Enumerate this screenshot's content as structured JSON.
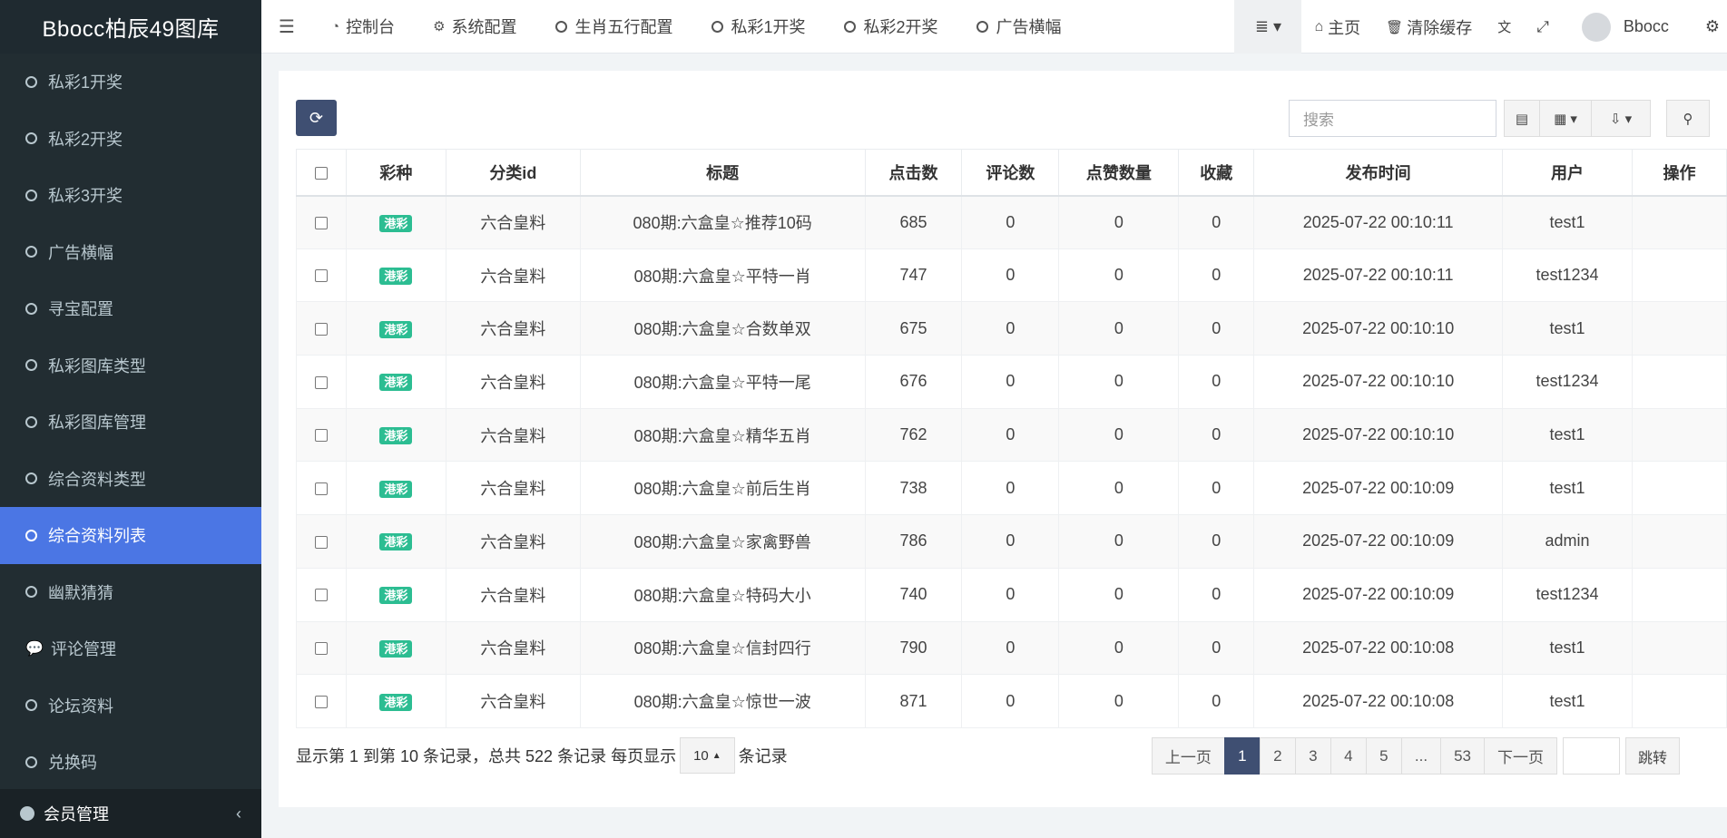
{
  "brand": "Bbocc柏辰49图库",
  "sidebar": {
    "items": [
      {
        "label": "私彩1开奖"
      },
      {
        "label": "私彩2开奖"
      },
      {
        "label": "私彩3开奖"
      },
      {
        "label": "广告横幅"
      },
      {
        "label": "寻宝配置"
      },
      {
        "label": "私彩图库类型"
      },
      {
        "label": "私彩图库管理"
      },
      {
        "label": "综合资料类型"
      },
      {
        "label": "综合资料列表"
      },
      {
        "label": "幽默猜猜"
      },
      {
        "label": "评论管理"
      },
      {
        "label": "论坛资料"
      },
      {
        "label": "兑换码"
      }
    ],
    "bottom_label": "会员管理"
  },
  "topbar": {
    "tabs": [
      {
        "label": "控制台"
      },
      {
        "label": "系统配置"
      },
      {
        "label": "生肖五行配置"
      },
      {
        "label": "私彩1开奖"
      },
      {
        "label": "私彩2开奖"
      },
      {
        "label": "广告横幅"
      }
    ],
    "home_label": "主页",
    "clear_cache_label": "清除缓存",
    "user_name": "Bbocc"
  },
  "toolbar": {
    "search_placeholder": "搜索"
  },
  "table": {
    "headers": [
      "彩种",
      "分类id",
      "标题",
      "点击数",
      "评论数",
      "点赞数量",
      "收藏",
      "发布时间",
      "用户",
      "操作"
    ],
    "rows": [
      {
        "badge": "港彩",
        "category": "六合皇料",
        "title": "080期:六盒皇☆推荐10码",
        "clicks": "685",
        "comments": "0",
        "likes": "0",
        "favorites": "0",
        "time": "2025-07-22 00:10:11",
        "user": "test1"
      },
      {
        "badge": "港彩",
        "category": "六合皇料",
        "title": "080期:六盒皇☆平特一肖",
        "clicks": "747",
        "comments": "0",
        "likes": "0",
        "favorites": "0",
        "time": "2025-07-22 00:10:11",
        "user": "test1234"
      },
      {
        "badge": "港彩",
        "category": "六合皇料",
        "title": "080期:六盒皇☆合数单双",
        "clicks": "675",
        "comments": "0",
        "likes": "0",
        "favorites": "0",
        "time": "2025-07-22 00:10:10",
        "user": "test1"
      },
      {
        "badge": "港彩",
        "category": "六合皇料",
        "title": "080期:六盒皇☆平特一尾",
        "clicks": "676",
        "comments": "0",
        "likes": "0",
        "favorites": "0",
        "time": "2025-07-22 00:10:10",
        "user": "test1234"
      },
      {
        "badge": "港彩",
        "category": "六合皇料",
        "title": "080期:六盒皇☆精华五肖",
        "clicks": "762",
        "comments": "0",
        "likes": "0",
        "favorites": "0",
        "time": "2025-07-22 00:10:10",
        "user": "test1"
      },
      {
        "badge": "港彩",
        "category": "六合皇料",
        "title": "080期:六盒皇☆前后生肖",
        "clicks": "738",
        "comments": "0",
        "likes": "0",
        "favorites": "0",
        "time": "2025-07-22 00:10:09",
        "user": "test1"
      },
      {
        "badge": "港彩",
        "category": "六合皇料",
        "title": "080期:六盒皇☆家禽野兽",
        "clicks": "786",
        "comments": "0",
        "likes": "0",
        "favorites": "0",
        "time": "2025-07-22 00:10:09",
        "user": "admin"
      },
      {
        "badge": "港彩",
        "category": "六合皇料",
        "title": "080期:六盒皇☆特码大小",
        "clicks": "740",
        "comments": "0",
        "likes": "0",
        "favorites": "0",
        "time": "2025-07-22 00:10:09",
        "user": "test1234"
      },
      {
        "badge": "港彩",
        "category": "六合皇料",
        "title": "080期:六盒皇☆信封四行",
        "clicks": "790",
        "comments": "0",
        "likes": "0",
        "favorites": "0",
        "time": "2025-07-22 00:10:08",
        "user": "test1"
      },
      {
        "badge": "港彩",
        "category": "六合皇料",
        "title": "080期:六盒皇☆惊世一波",
        "clicks": "871",
        "comments": "0",
        "likes": "0",
        "favorites": "0",
        "time": "2025-07-22 00:10:08",
        "user": "test1"
      }
    ]
  },
  "footer": {
    "info_prefix": "显示第 1 到第 10 条记录，总共 522 条记录 每页显示",
    "page_size": "10",
    "info_suffix": "条记录",
    "prev": "上一页",
    "pages": [
      "1",
      "2",
      "3",
      "4",
      "5",
      "...",
      "53"
    ],
    "next": "下一页",
    "jump": "跳转"
  },
  "colors": {
    "sidebar_bg": "#222d32",
    "active": "#4b76e4",
    "primary_btn": "#3f4f72",
    "badge": "#2cbd92"
  }
}
